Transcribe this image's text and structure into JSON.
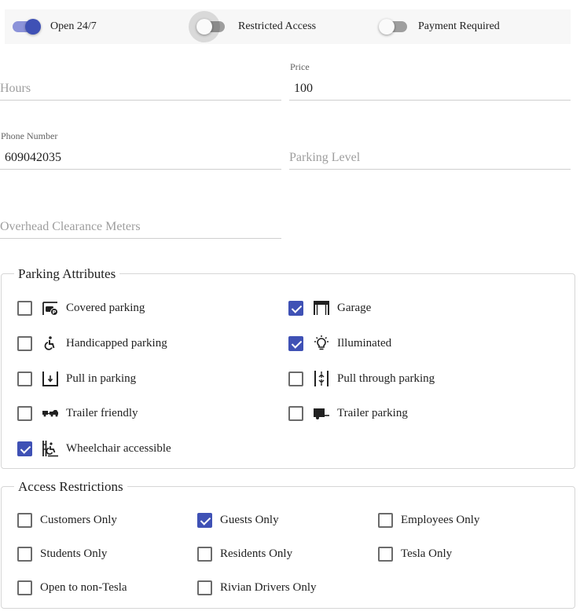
{
  "toggles": [
    {
      "label": "Open 24/7",
      "on": true
    },
    {
      "label": "Restricted Access",
      "on": false,
      "focused": true
    },
    {
      "label": "Payment Required",
      "on": false
    }
  ],
  "fields": {
    "hours": {
      "label": "",
      "placeholder": "Hours",
      "value": ""
    },
    "price": {
      "label": "Price",
      "placeholder": "",
      "value": "100"
    },
    "phone": {
      "label": "Phone Number",
      "placeholder": "",
      "value": "609042035"
    },
    "parking_level": {
      "label": "",
      "placeholder": "Parking Level",
      "value": ""
    },
    "overhead": {
      "label": "",
      "placeholder": "Overhead Clearance Meters",
      "value": ""
    }
  },
  "parking_attributes": {
    "legend": "Parking Attributes",
    "items": [
      {
        "label": "Covered parking",
        "checked": false,
        "icon": "covered-parking-icon"
      },
      {
        "label": "Garage",
        "checked": true,
        "icon": "garage-icon"
      },
      {
        "label": "Handicapped parking",
        "checked": false,
        "icon": "accessible-icon"
      },
      {
        "label": "Illuminated",
        "checked": true,
        "icon": "lightbulb-icon"
      },
      {
        "label": "Pull in parking",
        "checked": false,
        "icon": "pull-in-icon"
      },
      {
        "label": "Pull through parking",
        "checked": false,
        "icon": "pull-through-icon"
      },
      {
        "label": "Trailer friendly",
        "checked": false,
        "icon": "car-trailer-icon"
      },
      {
        "label": "Trailer parking",
        "checked": false,
        "icon": "trailer-icon"
      },
      {
        "label": "Wheelchair accessible",
        "checked": true,
        "icon": "wheelchair-ramp-icon"
      }
    ]
  },
  "access_restrictions": {
    "legend": "Access Restrictions",
    "items": [
      {
        "label": "Customers Only",
        "checked": false
      },
      {
        "label": "Guests Only",
        "checked": true
      },
      {
        "label": "Employees Only",
        "checked": false
      },
      {
        "label": "Students Only",
        "checked": false
      },
      {
        "label": "Residents Only",
        "checked": false
      },
      {
        "label": "Tesla Only",
        "checked": false
      },
      {
        "label": "Open to non-Tesla",
        "checked": false
      },
      {
        "label": "Rivian Drivers Only",
        "checked": false
      }
    ]
  },
  "colors": {
    "accent": "#3f51b5",
    "accent_light": "#8c93d9"
  }
}
